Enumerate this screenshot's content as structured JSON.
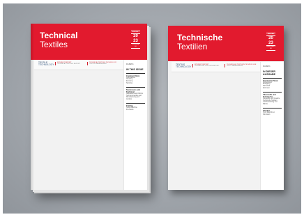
{
  "colors": {
    "brand_red": "#e21a2e",
    "backdrop": "#a3a8ae",
    "page": "#f2f2f2"
  },
  "magazines": [
    {
      "title_bold": "Technical",
      "title_light": "Textiles",
      "issue_top": "JANUARY",
      "issue_line1": "20",
      "issue_line2": "23",
      "issue_bottom": "VOLUME 66",
      "logo_line1": "TEXTILE",
      "logo_line2": "TECHNOLOGY",
      "headline_1": "INTEREST REPORT",
      "headline_1_sub": "TECHNICAL TEXTILES REPORT",
      "headline_2": "TECHNICAL TEXTILES TECHNOLOGY",
      "headline_2_sub": "TEXTILE MANAGEMENT",
      "sidebar_date": "01 2023 1",
      "sidebar_heading": "IN THIS ISSUE",
      "sections": [
        {
          "title": "Comment News",
          "lines": [
            "Conferences",
            "Cleaning",
            "Economy",
            "Spinning"
          ]
        },
        {
          "title": "Nonwovens and Technical",
          "lines": [
            "Nonwovens and fabrics",
            "Technical textiles and",
            "Manufacturing and",
            "markets"
          ]
        },
        {
          "title": "Knitting",
          "lines": [
            "Textile Machine",
            "Interviews"
          ]
        }
      ]
    },
    {
      "title_bold": "Technische",
      "title_light": "Textilien",
      "issue_top": "JANUAR",
      "issue_line1": "20",
      "issue_line2": "23",
      "issue_bottom": "JAHRGANG 66",
      "logo_line1": "TEXTILE",
      "logo_line2": "TECHNOLOGY",
      "headline_1": "INTEREST REPORT",
      "headline_1_sub": "TECHNISCHE TEXTILIEN REPORT",
      "headline_2": "TECHNISCHE TEXTILIEN TECHNOLOGIE",
      "headline_2_sub": "TEXTIL MANAGEMENT",
      "sidebar_date": "01 2023 1",
      "sidebar_heading": "IN DIESER AUSGABE",
      "sections": [
        {
          "title": "Kommentar News",
          "lines": [
            "Konferenzen",
            "Reinigung",
            "Wirtschaft",
            "Spinnerei"
          ]
        },
        {
          "title": "Vliesstoffe und Technische",
          "lines": [
            "Vliesstoffe und Gewebe",
            "Technische Textilien",
            "und Herstellung und",
            "Märkte"
          ]
        },
        {
          "title": "Stricken",
          "lines": [
            "Textil Maschinen",
            "Interviews"
          ]
        }
      ]
    }
  ]
}
